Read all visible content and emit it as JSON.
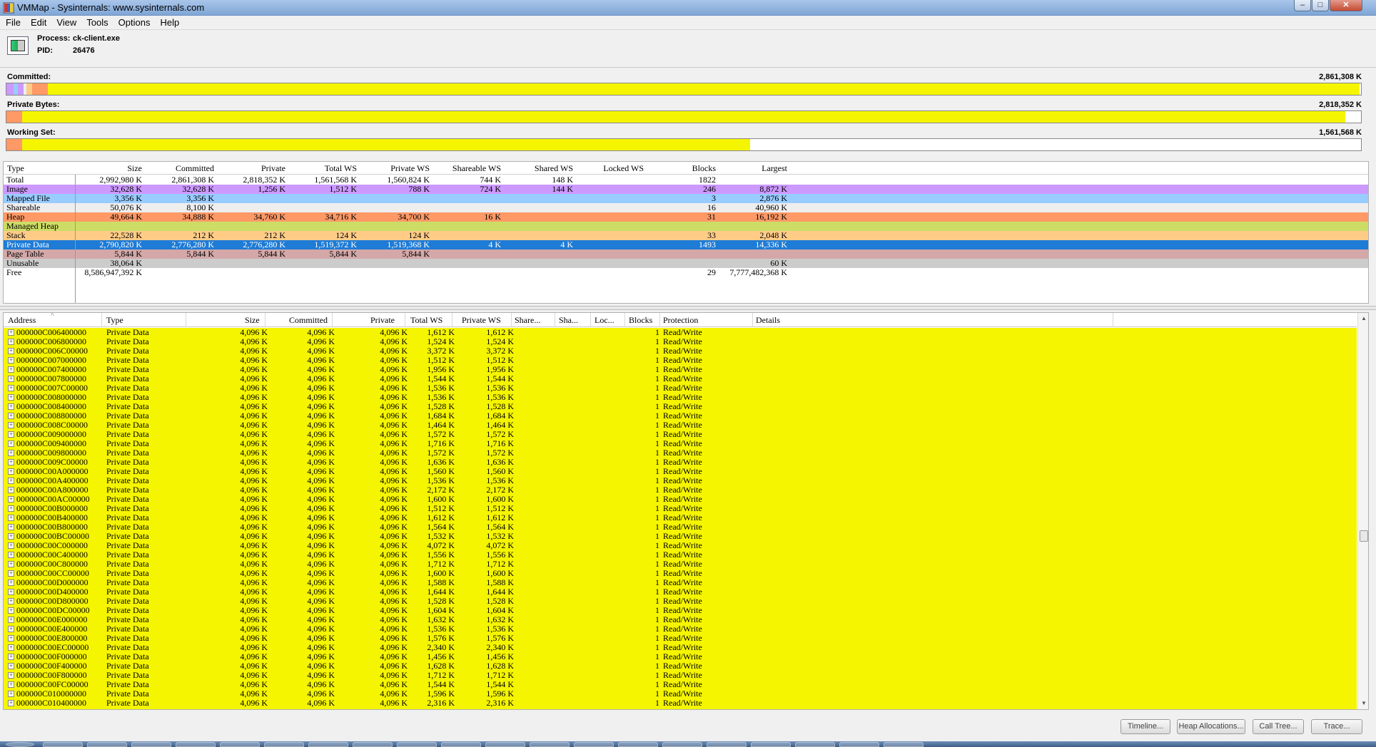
{
  "window": {
    "title": "VMMap - Sysinternals: www.sysinternals.com",
    "min_label": "–",
    "max_label": "□",
    "close_label": "✕"
  },
  "menu": [
    "File",
    "Edit",
    "View",
    "Tools",
    "Options",
    "Help"
  ],
  "process": {
    "process_label": "Process:",
    "process_name": "ck-client.exe",
    "pid_label": "PID:",
    "pid": "26476"
  },
  "usage_bars": {
    "committed": {
      "label": "Committed:",
      "value": "2,861,308 K"
    },
    "private_bytes": {
      "label": "Private Bytes:",
      "value": "2,818,352 K"
    },
    "working_set": {
      "label": "Working Set:",
      "value": "1,561,568 K"
    }
  },
  "colors": {
    "image": "#cc99ff",
    "mapped_file": "#99ccff",
    "shareable": "#eeeeee",
    "heap": "#ff9966",
    "managed_heap": "#ccdd66",
    "stack": "#ffcc88",
    "private_data": "#f5f500",
    "selected": "#1e7bd6",
    "page_table": "#d4a8a8",
    "unusable": "#cccccc"
  },
  "summary": {
    "columns": [
      "Type",
      "Size",
      "Committed",
      "Private",
      "Total WS",
      "Private WS",
      "Shareable WS",
      "Shared WS",
      "Locked WS",
      "Blocks",
      "Largest"
    ],
    "rows": [
      {
        "type": "Total",
        "size": "2,992,980 K",
        "committed": "2,861,308 K",
        "private": "2,818,352 K",
        "total_ws": "1,561,568 K",
        "private_ws": "1,560,824 K",
        "shareable_ws": "744 K",
        "shared_ws": "148 K",
        "locked_ws": "",
        "blocks": "1822",
        "largest": "",
        "color": "#ffffff"
      },
      {
        "type": "Image",
        "size": "32,628 K",
        "committed": "32,628 K",
        "private": "1,256 K",
        "total_ws": "1,512 K",
        "private_ws": "788 K",
        "shareable_ws": "724 K",
        "shared_ws": "144 K",
        "locked_ws": "",
        "blocks": "246",
        "largest": "8,872 K",
        "color": "#cc99ff"
      },
      {
        "type": "Mapped File",
        "size": "3,356 K",
        "committed": "3,356 K",
        "private": "",
        "total_ws": "",
        "private_ws": "",
        "shareable_ws": "",
        "shared_ws": "",
        "locked_ws": "",
        "blocks": "3",
        "largest": "2,876 K",
        "color": "#99ccff"
      },
      {
        "type": "Shareable",
        "size": "50,076 K",
        "committed": "8,100 K",
        "private": "",
        "total_ws": "",
        "private_ws": "",
        "shareable_ws": "",
        "shared_ws": "",
        "locked_ws": "",
        "blocks": "16",
        "largest": "40,960 K",
        "color": "#eeeeee"
      },
      {
        "type": "Heap",
        "size": "49,664 K",
        "committed": "34,888 K",
        "private": "34,760 K",
        "total_ws": "34,716 K",
        "private_ws": "34,700 K",
        "shareable_ws": "16 K",
        "shared_ws": "",
        "locked_ws": "",
        "blocks": "31",
        "largest": "16,192 K",
        "color": "#ff9966"
      },
      {
        "type": "Managed Heap",
        "size": "",
        "committed": "",
        "private": "",
        "total_ws": "",
        "private_ws": "",
        "shareable_ws": "",
        "shared_ws": "",
        "locked_ws": "",
        "blocks": "",
        "largest": "",
        "color": "#ccdd66"
      },
      {
        "type": "Stack",
        "size": "22,528 K",
        "committed": "212 K",
        "private": "212 K",
        "total_ws": "124 K",
        "private_ws": "124 K",
        "shareable_ws": "",
        "shared_ws": "",
        "locked_ws": "",
        "blocks": "33",
        "largest": "2,048 K",
        "color": "#ffcc88"
      },
      {
        "type": "Private Data",
        "size": "2,790,820 K",
        "committed": "2,776,280 K",
        "private": "2,776,280 K",
        "total_ws": "1,519,372 K",
        "private_ws": "1,519,368 K",
        "shareable_ws": "4 K",
        "shared_ws": "4 K",
        "locked_ws": "",
        "blocks": "1493",
        "largest": "14,336 K",
        "color": "#1e7bd6"
      },
      {
        "type": "Page Table",
        "size": "5,844 K",
        "committed": "5,844 K",
        "private": "5,844 K",
        "total_ws": "5,844 K",
        "private_ws": "5,844 K",
        "shareable_ws": "",
        "shared_ws": "",
        "locked_ws": "",
        "blocks": "",
        "largest": "",
        "color": "#d4a8a8"
      },
      {
        "type": "Unusable",
        "size": "38,064 K",
        "committed": "",
        "private": "",
        "total_ws": "",
        "private_ws": "",
        "shareable_ws": "",
        "shared_ws": "",
        "locked_ws": "",
        "blocks": "",
        "largest": "60 K",
        "color": "#cccccc"
      },
      {
        "type": "Free",
        "size": "8,586,947,392 K",
        "committed": "",
        "private": "",
        "total_ws": "",
        "private_ws": "",
        "shareable_ws": "",
        "shared_ws": "",
        "locked_ws": "",
        "blocks": "29",
        "largest": "7,777,482,368 K",
        "color": "#ffffff"
      }
    ]
  },
  "detail": {
    "columns": [
      "Address",
      "Type",
      "Size",
      "Committed",
      "Private",
      "Total WS",
      "Private WS",
      "Share...",
      "Sha...",
      "Loc...",
      "Blocks",
      "Protection",
      "Details"
    ],
    "sort_indicator": "^",
    "rows": [
      {
        "address": "000000C006400000",
        "type": "Private Data",
        "size": "4,096 K",
        "committed": "4,096 K",
        "private": "4,096 K",
        "total_ws": "1,612 K",
        "private_ws": "1,612 K",
        "blocks": "1",
        "protection": "Read/Write"
      },
      {
        "address": "000000C006800000",
        "type": "Private Data",
        "size": "4,096 K",
        "committed": "4,096 K",
        "private": "4,096 K",
        "total_ws": "1,524 K",
        "private_ws": "1,524 K",
        "blocks": "1",
        "protection": "Read/Write"
      },
      {
        "address": "000000C006C00000",
        "type": "Private Data",
        "size": "4,096 K",
        "committed": "4,096 K",
        "private": "4,096 K",
        "total_ws": "3,372 K",
        "private_ws": "3,372 K",
        "blocks": "1",
        "protection": "Read/Write"
      },
      {
        "address": "000000C007000000",
        "type": "Private Data",
        "size": "4,096 K",
        "committed": "4,096 K",
        "private": "4,096 K",
        "total_ws": "1,512 K",
        "private_ws": "1,512 K",
        "blocks": "1",
        "protection": "Read/Write"
      },
      {
        "address": "000000C007400000",
        "type": "Private Data",
        "size": "4,096 K",
        "committed": "4,096 K",
        "private": "4,096 K",
        "total_ws": "1,956 K",
        "private_ws": "1,956 K",
        "blocks": "1",
        "protection": "Read/Write"
      },
      {
        "address": "000000C007800000",
        "type": "Private Data",
        "size": "4,096 K",
        "committed": "4,096 K",
        "private": "4,096 K",
        "total_ws": "1,544 K",
        "private_ws": "1,544 K",
        "blocks": "1",
        "protection": "Read/Write"
      },
      {
        "address": "000000C007C00000",
        "type": "Private Data",
        "size": "4,096 K",
        "committed": "4,096 K",
        "private": "4,096 K",
        "total_ws": "1,536 K",
        "private_ws": "1,536 K",
        "blocks": "1",
        "protection": "Read/Write"
      },
      {
        "address": "000000C008000000",
        "type": "Private Data",
        "size": "4,096 K",
        "committed": "4,096 K",
        "private": "4,096 K",
        "total_ws": "1,536 K",
        "private_ws": "1,536 K",
        "blocks": "1",
        "protection": "Read/Write"
      },
      {
        "address": "000000C008400000",
        "type": "Private Data",
        "size": "4,096 K",
        "committed": "4,096 K",
        "private": "4,096 K",
        "total_ws": "1,528 K",
        "private_ws": "1,528 K",
        "blocks": "1",
        "protection": "Read/Write"
      },
      {
        "address": "000000C008800000",
        "type": "Private Data",
        "size": "4,096 K",
        "committed": "4,096 K",
        "private": "4,096 K",
        "total_ws": "1,684 K",
        "private_ws": "1,684 K",
        "blocks": "1",
        "protection": "Read/Write"
      },
      {
        "address": "000000C008C00000",
        "type": "Private Data",
        "size": "4,096 K",
        "committed": "4,096 K",
        "private": "4,096 K",
        "total_ws": "1,464 K",
        "private_ws": "1,464 K",
        "blocks": "1",
        "protection": "Read/Write"
      },
      {
        "address": "000000C009000000",
        "type": "Private Data",
        "size": "4,096 K",
        "committed": "4,096 K",
        "private": "4,096 K",
        "total_ws": "1,572 K",
        "private_ws": "1,572 K",
        "blocks": "1",
        "protection": "Read/Write"
      },
      {
        "address": "000000C009400000",
        "type": "Private Data",
        "size": "4,096 K",
        "committed": "4,096 K",
        "private": "4,096 K",
        "total_ws": "1,716 K",
        "private_ws": "1,716 K",
        "blocks": "1",
        "protection": "Read/Write"
      },
      {
        "address": "000000C009800000",
        "type": "Private Data",
        "size": "4,096 K",
        "committed": "4,096 K",
        "private": "4,096 K",
        "total_ws": "1,572 K",
        "private_ws": "1,572 K",
        "blocks": "1",
        "protection": "Read/Write"
      },
      {
        "address": "000000C009C00000",
        "type": "Private Data",
        "size": "4,096 K",
        "committed": "4,096 K",
        "private": "4,096 K",
        "total_ws": "1,636 K",
        "private_ws": "1,636 K",
        "blocks": "1",
        "protection": "Read/Write"
      },
      {
        "address": "000000C00A000000",
        "type": "Private Data",
        "size": "4,096 K",
        "committed": "4,096 K",
        "private": "4,096 K",
        "total_ws": "1,560 K",
        "private_ws": "1,560 K",
        "blocks": "1",
        "protection": "Read/Write"
      },
      {
        "address": "000000C00A400000",
        "type": "Private Data",
        "size": "4,096 K",
        "committed": "4,096 K",
        "private": "4,096 K",
        "total_ws": "1,536 K",
        "private_ws": "1,536 K",
        "blocks": "1",
        "protection": "Read/Write"
      },
      {
        "address": "000000C00A800000",
        "type": "Private Data",
        "size": "4,096 K",
        "committed": "4,096 K",
        "private": "4,096 K",
        "total_ws": "2,172 K",
        "private_ws": "2,172 K",
        "blocks": "1",
        "protection": "Read/Write"
      },
      {
        "address": "000000C00AC00000",
        "type": "Private Data",
        "size": "4,096 K",
        "committed": "4,096 K",
        "private": "4,096 K",
        "total_ws": "1,600 K",
        "private_ws": "1,600 K",
        "blocks": "1",
        "protection": "Read/Write"
      },
      {
        "address": "000000C00B000000",
        "type": "Private Data",
        "size": "4,096 K",
        "committed": "4,096 K",
        "private": "4,096 K",
        "total_ws": "1,512 K",
        "private_ws": "1,512 K",
        "blocks": "1",
        "protection": "Read/Write"
      },
      {
        "address": "000000C00B400000",
        "type": "Private Data",
        "size": "4,096 K",
        "committed": "4,096 K",
        "private": "4,096 K",
        "total_ws": "1,612 K",
        "private_ws": "1,612 K",
        "blocks": "1",
        "protection": "Read/Write"
      },
      {
        "address": "000000C00B800000",
        "type": "Private Data",
        "size": "4,096 K",
        "committed": "4,096 K",
        "private": "4,096 K",
        "total_ws": "1,564 K",
        "private_ws": "1,564 K",
        "blocks": "1",
        "protection": "Read/Write"
      },
      {
        "address": "000000C00BC00000",
        "type": "Private Data",
        "size": "4,096 K",
        "committed": "4,096 K",
        "private": "4,096 K",
        "total_ws": "1,532 K",
        "private_ws": "1,532 K",
        "blocks": "1",
        "protection": "Read/Write"
      },
      {
        "address": "000000C00C000000",
        "type": "Private Data",
        "size": "4,096 K",
        "committed": "4,096 K",
        "private": "4,096 K",
        "total_ws": "4,072 K",
        "private_ws": "4,072 K",
        "blocks": "1",
        "protection": "Read/Write"
      },
      {
        "address": "000000C00C400000",
        "type": "Private Data",
        "size": "4,096 K",
        "committed": "4,096 K",
        "private": "4,096 K",
        "total_ws": "1,556 K",
        "private_ws": "1,556 K",
        "blocks": "1",
        "protection": "Read/Write"
      },
      {
        "address": "000000C00C800000",
        "type": "Private Data",
        "size": "4,096 K",
        "committed": "4,096 K",
        "private": "4,096 K",
        "total_ws": "1,712 K",
        "private_ws": "1,712 K",
        "blocks": "1",
        "protection": "Read/Write"
      },
      {
        "address": "000000C00CC00000",
        "type": "Private Data",
        "size": "4,096 K",
        "committed": "4,096 K",
        "private": "4,096 K",
        "total_ws": "1,600 K",
        "private_ws": "1,600 K",
        "blocks": "1",
        "protection": "Read/Write"
      },
      {
        "address": "000000C00D000000",
        "type": "Private Data",
        "size": "4,096 K",
        "committed": "4,096 K",
        "private": "4,096 K",
        "total_ws": "1,588 K",
        "private_ws": "1,588 K",
        "blocks": "1",
        "protection": "Read/Write"
      },
      {
        "address": "000000C00D400000",
        "type": "Private Data",
        "size": "4,096 K",
        "committed": "4,096 K",
        "private": "4,096 K",
        "total_ws": "1,644 K",
        "private_ws": "1,644 K",
        "blocks": "1",
        "protection": "Read/Write"
      },
      {
        "address": "000000C00D800000",
        "type": "Private Data",
        "size": "4,096 K",
        "committed": "4,096 K",
        "private": "4,096 K",
        "total_ws": "1,528 K",
        "private_ws": "1,528 K",
        "blocks": "1",
        "protection": "Read/Write"
      },
      {
        "address": "000000C00DC00000",
        "type": "Private Data",
        "size": "4,096 K",
        "committed": "4,096 K",
        "private": "4,096 K",
        "total_ws": "1,604 K",
        "private_ws": "1,604 K",
        "blocks": "1",
        "protection": "Read/Write"
      },
      {
        "address": "000000C00E000000",
        "type": "Private Data",
        "size": "4,096 K",
        "committed": "4,096 K",
        "private": "4,096 K",
        "total_ws": "1,632 K",
        "private_ws": "1,632 K",
        "blocks": "1",
        "protection": "Read/Write"
      },
      {
        "address": "000000C00E400000",
        "type": "Private Data",
        "size": "4,096 K",
        "committed": "4,096 K",
        "private": "4,096 K",
        "total_ws": "1,536 K",
        "private_ws": "1,536 K",
        "blocks": "1",
        "protection": "Read/Write"
      },
      {
        "address": "000000C00E800000",
        "type": "Private Data",
        "size": "4,096 K",
        "committed": "4,096 K",
        "private": "4,096 K",
        "total_ws": "1,576 K",
        "private_ws": "1,576 K",
        "blocks": "1",
        "protection": "Read/Write"
      },
      {
        "address": "000000C00EC00000",
        "type": "Private Data",
        "size": "4,096 K",
        "committed": "4,096 K",
        "private": "4,096 K",
        "total_ws": "2,340 K",
        "private_ws": "2,340 K",
        "blocks": "1",
        "protection": "Read/Write"
      },
      {
        "address": "000000C00F000000",
        "type": "Private Data",
        "size": "4,096 K",
        "committed": "4,096 K",
        "private": "4,096 K",
        "total_ws": "1,456 K",
        "private_ws": "1,456 K",
        "blocks": "1",
        "protection": "Read/Write"
      },
      {
        "address": "000000C00F400000",
        "type": "Private Data",
        "size": "4,096 K",
        "committed": "4,096 K",
        "private": "4,096 K",
        "total_ws": "1,628 K",
        "private_ws": "1,628 K",
        "blocks": "1",
        "protection": "Read/Write"
      },
      {
        "address": "000000C00F800000",
        "type": "Private Data",
        "size": "4,096 K",
        "committed": "4,096 K",
        "private": "4,096 K",
        "total_ws": "1,712 K",
        "private_ws": "1,712 K",
        "blocks": "1",
        "protection": "Read/Write"
      },
      {
        "address": "000000C00FC00000",
        "type": "Private Data",
        "size": "4,096 K",
        "committed": "4,096 K",
        "private": "4,096 K",
        "total_ws": "1,544 K",
        "private_ws": "1,544 K",
        "blocks": "1",
        "protection": "Read/Write"
      },
      {
        "address": "000000C010000000",
        "type": "Private Data",
        "size": "4,096 K",
        "committed": "4,096 K",
        "private": "4,096 K",
        "total_ws": "1,596 K",
        "private_ws": "1,596 K",
        "blocks": "1",
        "protection": "Read/Write"
      },
      {
        "address": "000000C010400000",
        "type": "Private Data",
        "size": "4,096 K",
        "committed": "4,096 K",
        "private": "4,096 K",
        "total_ws": "2,316 K",
        "private_ws": "2,316 K",
        "blocks": "1",
        "protection": "Read/Write"
      }
    ]
  },
  "buttons": [
    "Timeline...",
    "Heap Allocations...",
    "Call Tree...",
    "Trace..."
  ],
  "scroll": {
    "up": "▲",
    "down": "▼"
  }
}
